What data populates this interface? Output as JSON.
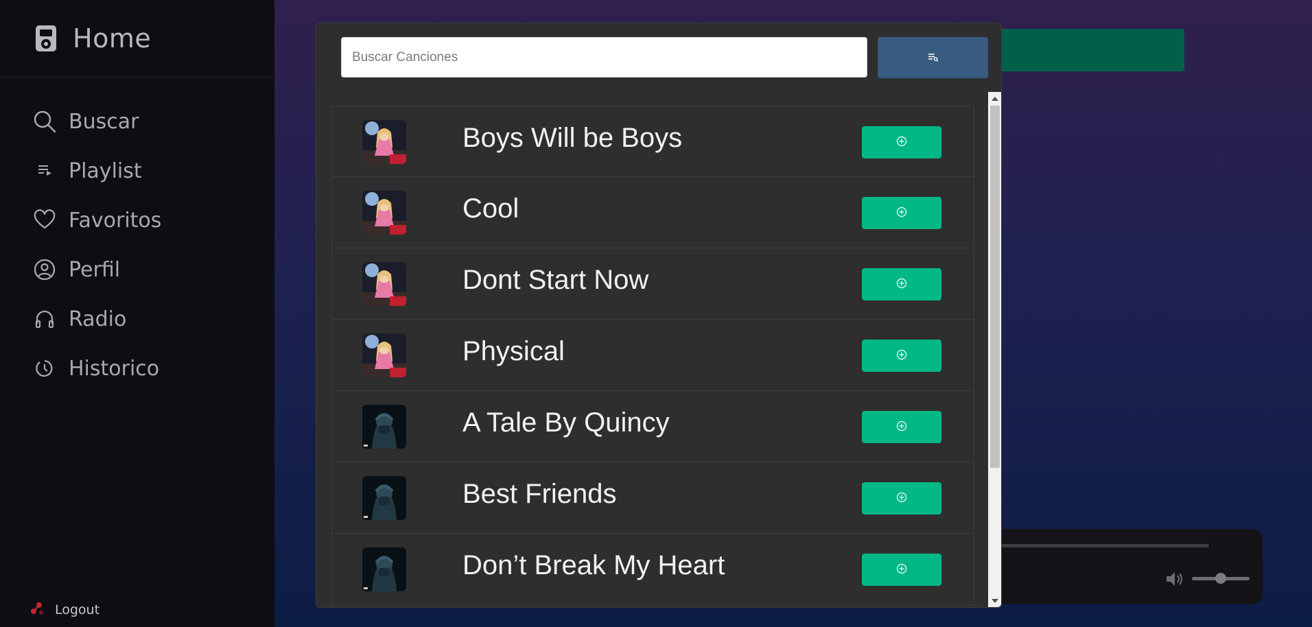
{
  "app": {
    "title": "Home"
  },
  "sidebar": {
    "items": [
      {
        "label": "Buscar",
        "icon": "search-icon"
      },
      {
        "label": "Playlist",
        "icon": "playlist-icon"
      },
      {
        "label": "Favoritos",
        "icon": "heart-icon"
      },
      {
        "label": "Perfil",
        "icon": "user-circle-icon"
      },
      {
        "label": "Radio",
        "icon": "headphones-icon"
      },
      {
        "label": "Historico",
        "icon": "history-icon"
      }
    ],
    "logout_label": "Logout"
  },
  "modal": {
    "search": {
      "placeholder": "Buscar Canciones",
      "value": ""
    },
    "search_button_icon": "playlist-search-icon",
    "songs": [
      {
        "title": "Boys Will be Boys",
        "cover": "album-cover-pink"
      },
      {
        "title": "Cool",
        "cover": "album-cover-pink"
      },
      {
        "title": "Dont Start Now",
        "cover": "album-cover-pink"
      },
      {
        "title": "Physical",
        "cover": "album-cover-pink"
      },
      {
        "title": "A Tale By Quincy",
        "cover": "album-cover-dark"
      },
      {
        "title": "Best Friends",
        "cover": "album-cover-dark"
      },
      {
        "title": "Don’t Break My Heart",
        "cover": "album-cover-dark"
      }
    ],
    "add_button_icon": "plus-circle-icon"
  },
  "colors": {
    "accent_green": "#00b886",
    "search_button": "#385b80",
    "sidebar_bg": "#0e0d14",
    "modal_bg": "#2e2e2e"
  }
}
